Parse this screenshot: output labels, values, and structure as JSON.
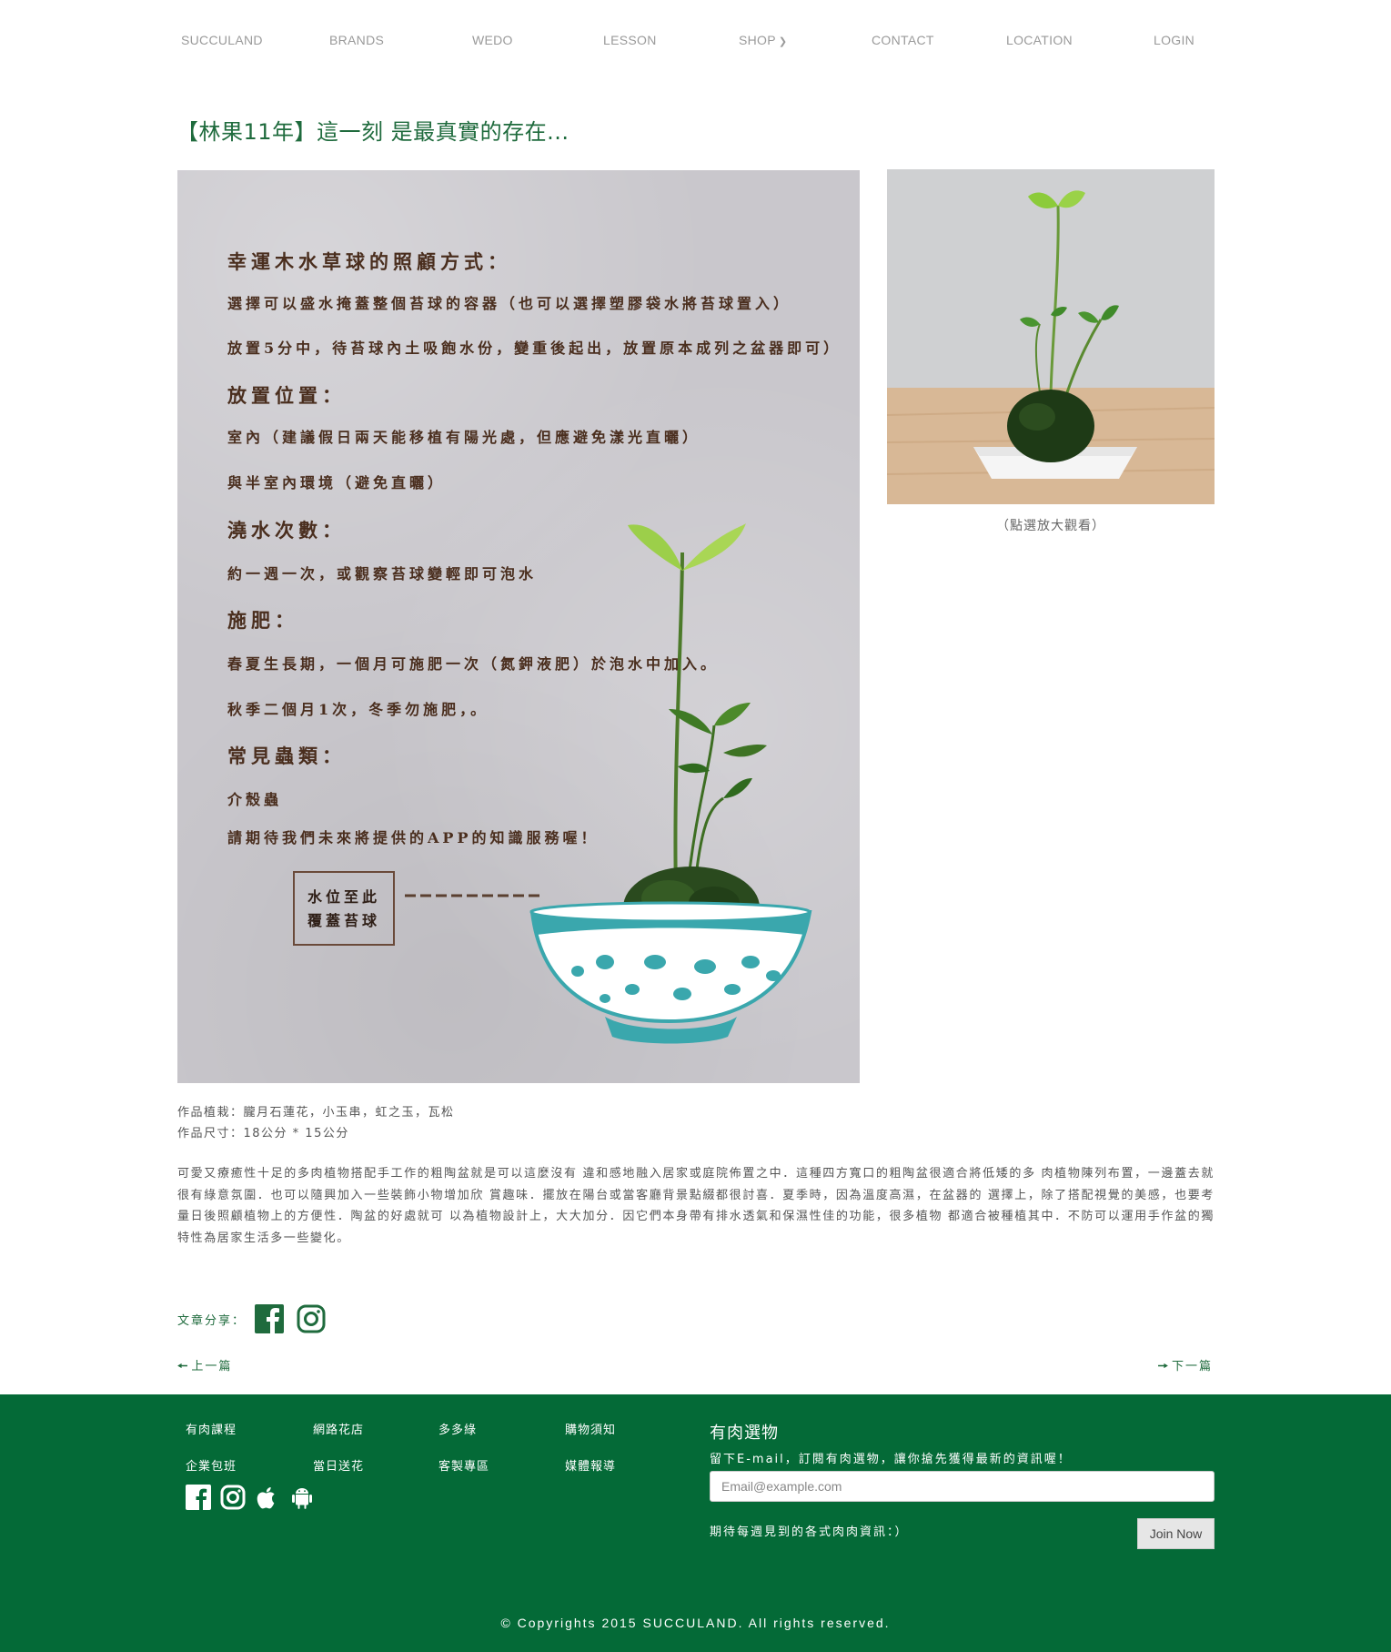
{
  "nav": {
    "items": [
      {
        "label": "SUCCULAND"
      },
      {
        "label": "BRANDS"
      },
      {
        "label": "WEDO"
      },
      {
        "label": "LESSON"
      },
      {
        "label": "SHOP"
      },
      {
        "label": "CONTACT"
      },
      {
        "label": "LOCATION"
      },
      {
        "label": "LOGIN"
      }
    ],
    "shop_dropdown_icon": "chevron-down-icon"
  },
  "article": {
    "title": "【林果11年】這一刻 是最真實的存在...",
    "poster": {
      "lines": [
        "幸運木水草球的照顧方式：",
        "選擇可以盛水掩蓋整個苔球的容器（也可以選擇塑膠袋水將苔球置入）",
        "放置5分中，待苔球內土吸飽水份，變重後起出，放置原本成列之盆器即可）",
        "放置位置：",
        "室內（建議假日兩天能移植有陽光處，但應避免漾光直曬）",
        "與半室內環境（避免直曬）",
        "澆水次數：",
        "約一週一次，或觀察苔球變輕即可泡水",
        "施肥：",
        "春夏生長期，一個月可施肥一次（氮鉀液肥）於泡水中加入。",
        "秋季二個月1次，冬季勿施肥，。",
        "常見蟲類：",
        "介殼蟲",
        "請期待我們未來將提供的APP的知識服務喔！"
      ],
      "tag_line1": "水位至此",
      "tag_line2": "覆蓋苔球"
    },
    "thumb_caption": "（點選放大觀看）",
    "meta_plants": "作品植栽：朧月石蓮花，小玉串，虹之玉，瓦松",
    "meta_size": "作品尺寸：18公分 * 15公分",
    "description": "可愛又療癒性十足的多肉植物搭配手工作的粗陶盆就是可以這麼沒有 違和感地融入居家或庭院佈置之中．這種四方寬口的粗陶盆很適合將低矮的多 肉植物陳列布置，一邊蓋去就很有綠意氛圍．也可以隨興加入一些裝飾小物增加欣 賞趣味．擺放在陽台或當客廳背景點綴都很討喜．夏季時，因為溫度高濕，在盆器的 選擇上，除了搭配視覺的美感，也要考量日後照顧植物上的方便性．陶盆的好處就可 以為植物設計上，大大加分．因它們本身帶有排水透氣和保濕性佳的功能，很多植物 都適合被種植其中．不防可以運用手作盆的獨特性為居家生活多一些變化。",
    "share_label": "文章分享：",
    "prev_label": "上一篇",
    "next_label": "下一篇"
  },
  "footer": {
    "links": [
      {
        "label": "有肉課程"
      },
      {
        "label": "網路花店"
      },
      {
        "label": "多多綠"
      },
      {
        "label": "購物須知"
      },
      {
        "label": "企業包班"
      },
      {
        "label": "當日送花"
      },
      {
        "label": "客製專區"
      },
      {
        "label": "媒體報導"
      }
    ],
    "newsletter": {
      "title": "有肉選物",
      "subtitle": "留下E-mail，訂閱有肉選物，讓你搶先獲得最新的資訊喔！",
      "placeholder": "Email@example.com",
      "note": "期待每週見到的各式肉肉資訊：）",
      "button": "Join Now"
    },
    "copyright": "© Copyrights 2015 SUCCULAND. All rights reserved."
  },
  "colors": {
    "brand_green": "#1f6b3d",
    "footer_green": "#046a37",
    "nav_gray": "#9a9a9a",
    "poster_bg": "#c9c7cc",
    "bowl_teal": "#3aa7ad"
  }
}
